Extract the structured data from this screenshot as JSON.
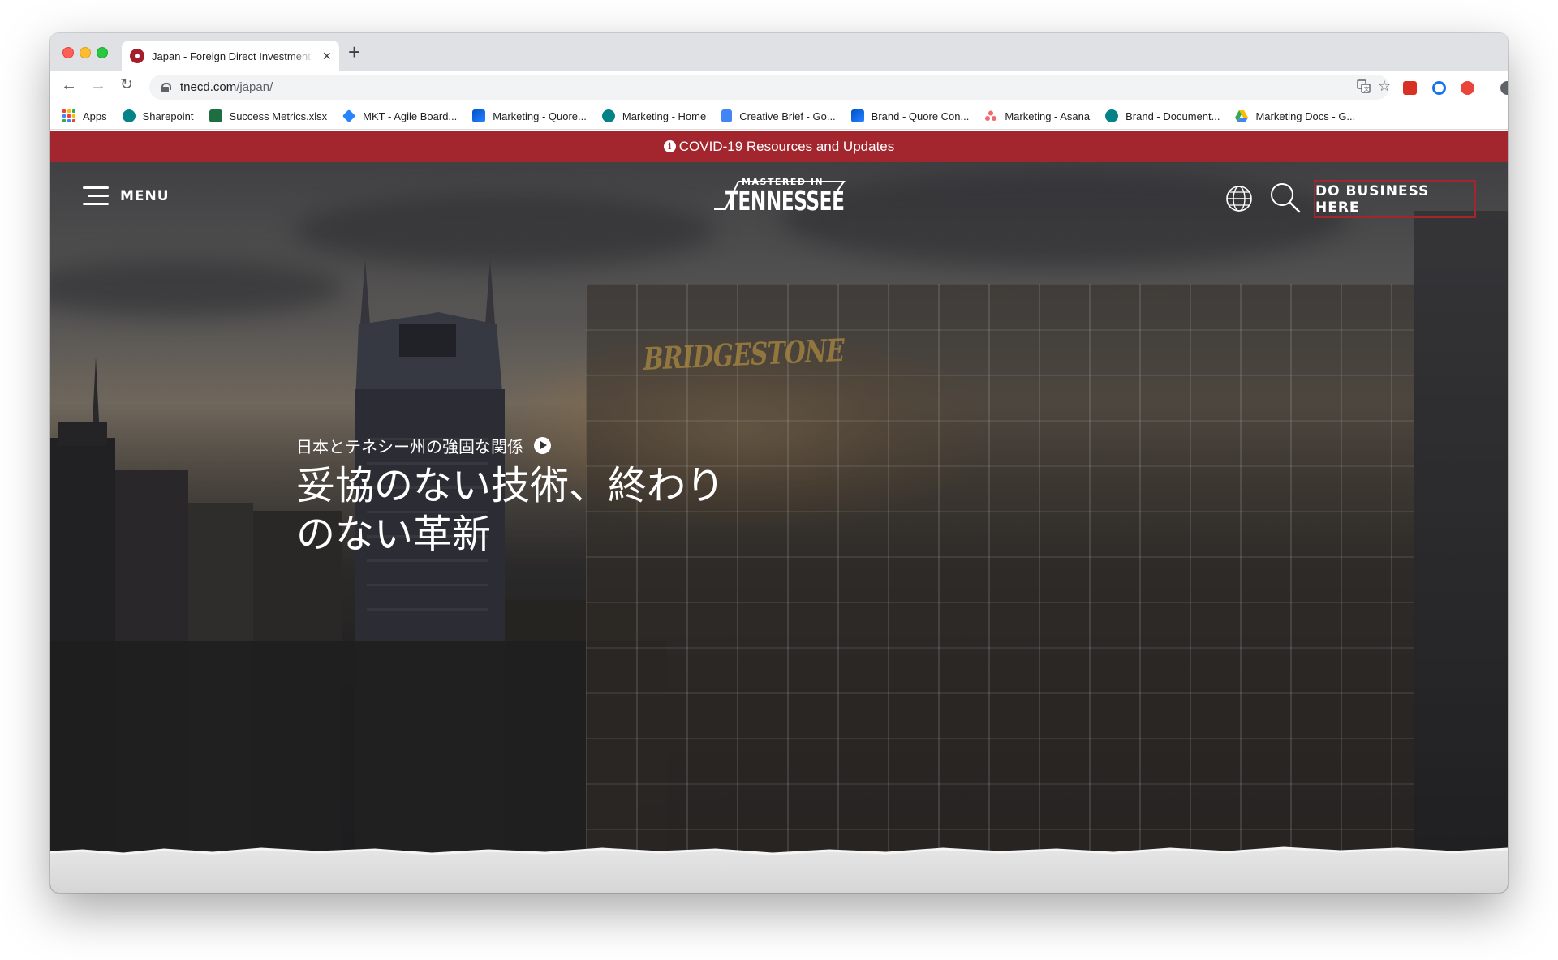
{
  "browser": {
    "tab": {
      "title": "Japan - Foreign Direct Investment",
      "favicon": "tn-state-seal-icon"
    },
    "url": {
      "domain": "tnecd.com",
      "path": "/japan/"
    },
    "bookmarks": [
      {
        "label": "Apps",
        "icon": "apps-grid-icon"
      },
      {
        "label": "Sharepoint",
        "icon": "sharepoint-icon"
      },
      {
        "label": "Success Metrics.xlsx",
        "icon": "excel-icon"
      },
      {
        "label": "MKT - Agile Board...",
        "icon": "jira-icon"
      },
      {
        "label": "Marketing - Quore...",
        "icon": "confluence-icon"
      },
      {
        "label": "Marketing - Home",
        "icon": "sharepoint-icon"
      },
      {
        "label": "Creative Brief - Go...",
        "icon": "google-docs-icon"
      },
      {
        "label": "Brand - Quore Con...",
        "icon": "confluence-icon"
      },
      {
        "label": "Marketing - Asana",
        "icon": "asana-icon"
      },
      {
        "label": "Brand - Document...",
        "icon": "sharepoint-icon"
      },
      {
        "label": "Marketing Docs - G...",
        "icon": "google-drive-icon"
      }
    ]
  },
  "site": {
    "alert": {
      "text": "COVID-19 Resources and Updates",
      "icon": "info-icon"
    },
    "nav": {
      "menu_label": "MENU",
      "logo_top": "MASTERED IN",
      "logo_main": "TENNESSEE",
      "cta_label": "DO BUSINESS HERE"
    },
    "hero": {
      "subtitle": "日本とテネシー州の強固な関係",
      "headline_line1": "妥協のない技術、終わり",
      "headline_line2": "のない革新",
      "building_sign": "BRIDGESTONE"
    }
  },
  "colors": {
    "brand_red": "#a3262f",
    "alert_bg": "#a3262f",
    "text_on_dark": "#ffffff"
  }
}
